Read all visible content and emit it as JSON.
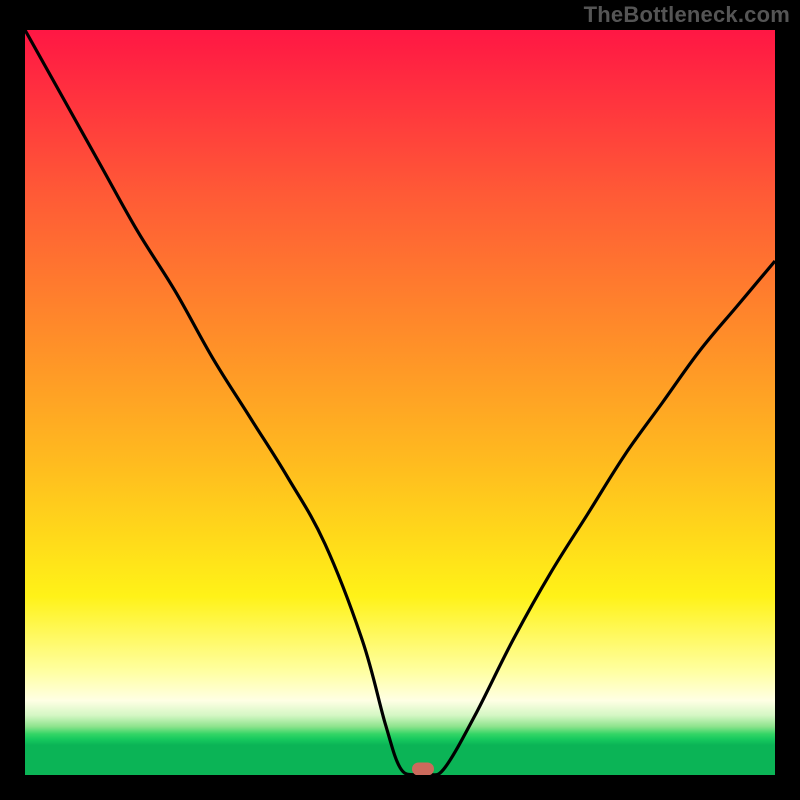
{
  "watermark": "TheBottleneck.com",
  "colors": {
    "frame_bg": "#000000",
    "curve": "#000000",
    "marker": "#cc6a5c"
  },
  "chart_data": {
    "type": "line",
    "title": "",
    "xlabel": "",
    "ylabel": "",
    "xlim": [
      0,
      100
    ],
    "ylim": [
      0,
      100
    ],
    "grid": false,
    "legend": false,
    "annotations": [
      {
        "text": "TheBottleneck.com",
        "position": "top-right"
      }
    ],
    "series": [
      {
        "name": "bottleneck-curve",
        "x": [
          0,
          5,
          10,
          15,
          20,
          25,
          30,
          35,
          40,
          45,
          48,
          50,
          52,
          54,
          56,
          60,
          65,
          70,
          75,
          80,
          85,
          90,
          95,
          100
        ],
        "y": [
          100,
          91,
          82,
          73,
          65,
          56,
          48,
          40,
          31,
          18,
          7,
          1,
          0,
          0,
          1,
          8,
          18,
          27,
          35,
          43,
          50,
          57,
          63,
          69
        ]
      }
    ],
    "marker": {
      "x": 53,
      "y": 0
    },
    "background_gradient": {
      "orientation": "vertical",
      "stops": [
        {
          "pos": 0.0,
          "color": "#ff1744"
        },
        {
          "pos": 0.46,
          "color": "#ff9a26"
        },
        {
          "pos": 0.76,
          "color": "#fff218"
        },
        {
          "pos": 0.9,
          "color": "#ffffe4"
        },
        {
          "pos": 0.95,
          "color": "#16c95e"
        },
        {
          "pos": 1.0,
          "color": "#0bb456"
        }
      ]
    }
  }
}
